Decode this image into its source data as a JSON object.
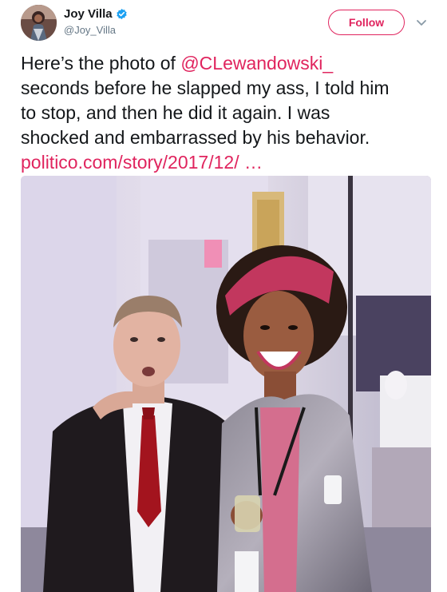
{
  "user": {
    "name": "Joy Villa",
    "handle": "@Joy_Villa",
    "verified": true,
    "avatar_icon": "profile-photo"
  },
  "actions": {
    "follow_label": "Follow",
    "menu_icon": "chevron-down-icon"
  },
  "tweet": {
    "line1_prefix": "Here’s the photo of ",
    "mention": "@CLewandowski_",
    "line2": "seconds before he slapped my ass, I told him",
    "line3": "to stop, and then he did it again. I was",
    "line4": "shocked and embarrassed by his behavior.",
    "link": "politico.com/story/2017/12/",
    "ellipsis": "  …"
  },
  "colors": {
    "accent": "#e0245e",
    "text": "#14171a",
    "muted": "#657786",
    "verified": "#1da1f2"
  }
}
